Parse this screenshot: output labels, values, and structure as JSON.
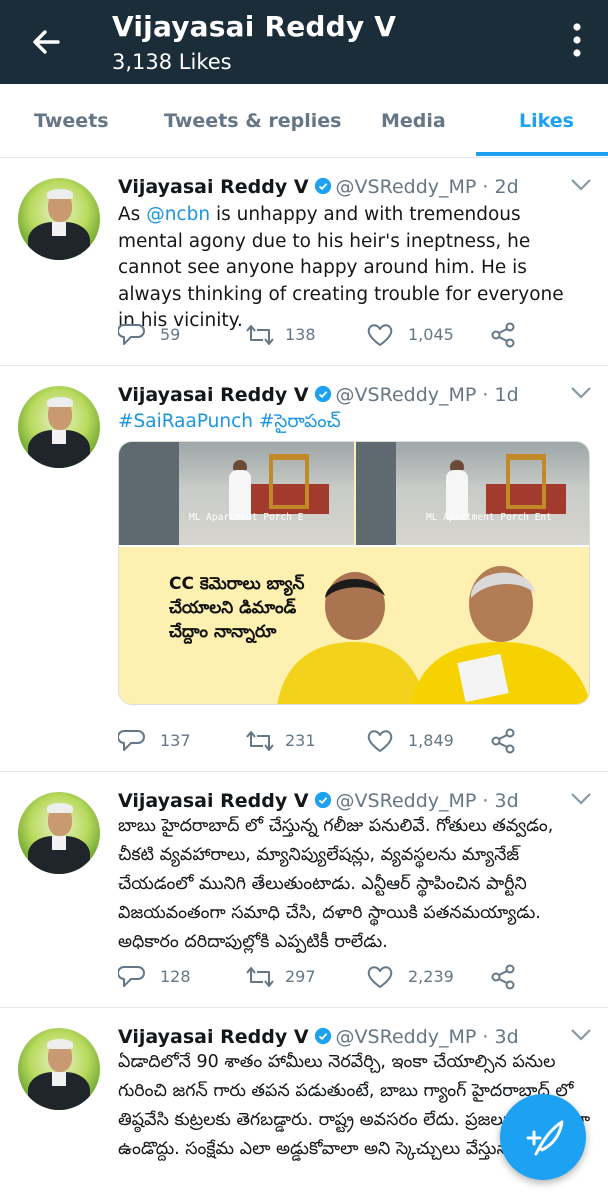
{
  "header": {
    "title": "Vijayasai Reddy V",
    "subtitle": "3,138 Likes"
  },
  "tabs": [
    {
      "label": "Tweets"
    },
    {
      "label": "Tweets & replies"
    },
    {
      "label": "Media"
    },
    {
      "label": "Likes"
    }
  ],
  "colors": {
    "accent": "#1da1f2",
    "header_bg": "#1c2d3a",
    "muted": "#657786"
  },
  "tweets": [
    {
      "name": "Vijayasai Reddy V",
      "handle": "@VSReddy_MP",
      "dot": "·",
      "time": "2d",
      "text_pre": "As ",
      "mention": "@ncbn",
      "text_post": " is unhappy and with tremendous mental agony due to his heir's ineptness, he cannot see anyone happy around him. He is always thinking of creating trouble for everyone in his vicinity.",
      "replies": "59",
      "retweets": "138",
      "likes": "1,045"
    },
    {
      "name": "Vijayasai Reddy V",
      "handle": "@VSReddy_MP",
      "dot": "·",
      "time": "1d",
      "hashtags": "#SaiRaaPunch #సైరాపంచ్",
      "image": {
        "caption_left": "ML Apartment Porch E",
        "caption_right": "ML Apartment Porch Ent",
        "meme_text": "CC కెమెరాలు బ్యాన్ చేయాలని డిమాండ్ చేద్దాం నాన్నారూ"
      },
      "replies": "137",
      "retweets": "231",
      "likes": "1,849"
    },
    {
      "name": "Vijayasai Reddy V",
      "handle": "@VSReddy_MP",
      "dot": "·",
      "time": "3d",
      "text": "బాబు హైదరాబాద్ లో చేస్తున్న గలీజు పనులివే. గోతులు తవ్వడం, చీకటి వ్యవహారాలు, మ్యానిప్యులేషన్లు, వ్యవస్థలను మ్యానేజ్ చేయడంలో మునిగి తేలుతుంటాడు. ఎన్టీఆర్ స్థాపించిన పార్టీని విజయవంతంగా సమాధి చేసి, దళారి స్థాయికి పతనమయ్యాడు. అధికారం దరిదాపుల్లోకి ఎప్పటికీ రాలేడు.",
      "replies": "128",
      "retweets": "297",
      "likes": "2,239"
    },
    {
      "name": "Vijayasai Reddy V",
      "handle": "@VSReddy_MP",
      "dot": "·",
      "time": "3d",
      "text": "ఏడాదిలోనే 90 శాతం హామీలు నెరవేర్చి, ఇంకా చేయాల్సిన పనుల గురించి జగన్ గారు తపన పడుతుంటే, బాబు గ్యాంగ్ హైదరాబాద్ లో తిష్ఠవేసి కుట్రలకు తెగబడ్డారు. రాష్ట్ర అవసరం లేదు. ప్రజలు సంతోషంగా ఉండొద్దు. సంక్షేమ ఎలా అడ్డుకోవాలా అని స్కెచ్చులు వేస్తున్నారు."
    }
  ]
}
